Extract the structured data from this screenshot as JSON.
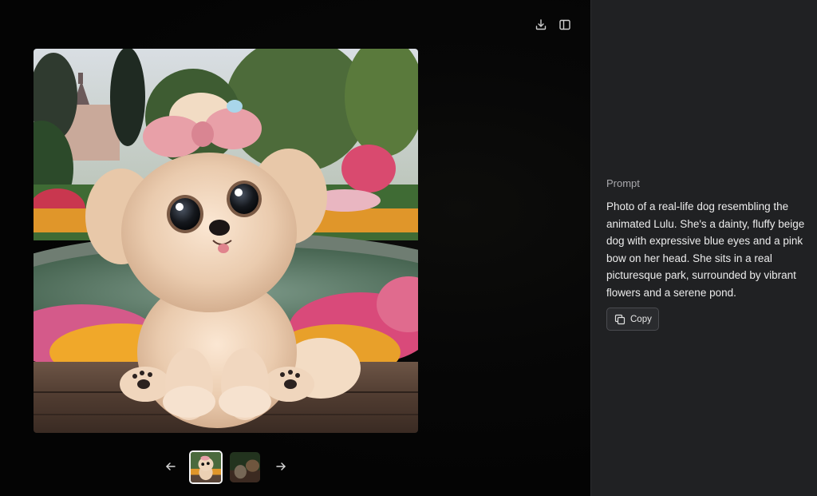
{
  "viewer": {
    "main_image": {
      "icon": "generated-dog-image"
    },
    "toolbar": {
      "download_icon": "download-icon",
      "sidebar_icon": "sidebar-toggle-icon"
    },
    "thumbnails": [
      {
        "icon": "thumbnail-dog",
        "selected": true
      },
      {
        "icon": "thumbnail-dog-alt",
        "selected": false
      }
    ],
    "nav": {
      "prev_icon": "arrow-left-icon",
      "next_icon": "arrow-right-icon"
    }
  },
  "sidebar": {
    "prompt_label": "Prompt",
    "prompt_text": "Photo of a real-life dog resembling the animated Lulu. She's a dainty, fluffy beige dog with expressive blue eyes and a pink bow on her head. She sits in a real picturesque park, surrounded by vibrant flowers and a serene pond.",
    "copy_label": "Copy",
    "copy_icon": "copy-icon"
  },
  "colors": {
    "sidebar_bg": "#202123",
    "viewer_bg": "#050505",
    "text_primary": "#ececec",
    "text_secondary": "#a9a9ad"
  }
}
